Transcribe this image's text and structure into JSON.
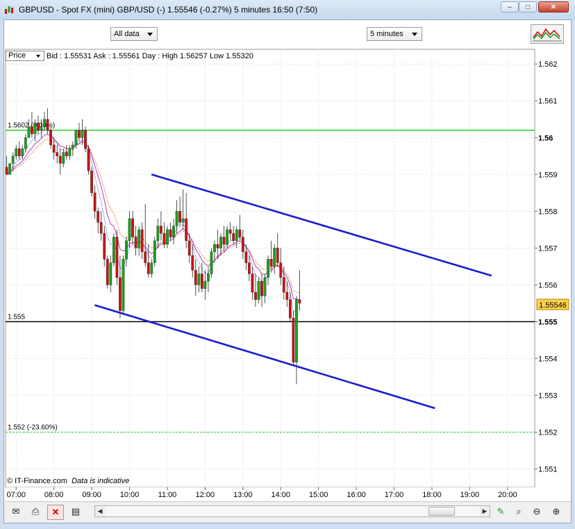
{
  "window": {
    "title": "GBPUSD - Spot FX (mini) GBP/USD (-)    1.55546 (-0.27%)    5 minutes  16:50 (7:50)",
    "minimize": "–",
    "maximize": "□",
    "close": "✕"
  },
  "toolbar": {
    "range_select": "All data",
    "interval_select": "5 minutes",
    "studies_icon": "chart-studies-icon"
  },
  "header": {
    "price_tab": "Price",
    "info": "Bid : 1.55531  Ask : 1.55561   Day : High 1.56257  Low 1.55320"
  },
  "copyright": {
    "brand": "© IT-Finance.com",
    "note": "Data is indicative"
  },
  "colors": {
    "up": "#1aa01a",
    "down": "#cc1111",
    "trendline": "#1a1ad0",
    "level_green": "#22cc22",
    "level_black": "#000000",
    "last_price_bg": "#ffd24a"
  },
  "chart_data": {
    "type": "candlestick",
    "x_ticks": [
      "07:00",
      "08:00",
      "09:00",
      "10:00",
      "11:00",
      "12:00",
      "13:00",
      "14:00",
      "15:00",
      "16:00",
      "17:00",
      "18:00",
      "19:00",
      "20:00"
    ],
    "y_ticks": [
      "1.562",
      "1.561",
      "1.56",
      "1.559",
      "1.558",
      "1.557",
      "1.556",
      "1.555",
      "1.554",
      "1.553",
      "1.552",
      "1.551"
    ],
    "bold_y_ticks": [
      "1.56",
      "1.555"
    ],
    "ylim": [
      1.5505,
      1.5624
    ],
    "x_range_hours": [
      6.72,
      20.72
    ],
    "last_price": "1.55546",
    "levels": [
      {
        "value": 1.5602,
        "label": "1.5602 (0.00%)",
        "color": "#22cc22",
        "style": "solid"
      },
      {
        "value": 1.555,
        "label": "1.555",
        "color": "#000000",
        "style": "solid"
      },
      {
        "value": 1.552,
        "label": "1.552 (-23.60%)",
        "color": "#22cc22",
        "style": "dashed"
      }
    ],
    "trendlines": [
      {
        "t1": 10.58,
        "v1": 1.559,
        "t2": 19.58,
        "v2": 1.55625
      },
      {
        "t1": 9.08,
        "v1": 1.55545,
        "t2": 18.08,
        "v2": 1.55265
      }
    ],
    "candles": [
      [
        1.5592,
        1.5595,
        1.559,
        1.559
      ],
      [
        1.559,
        1.5593,
        1.559,
        1.5593
      ],
      [
        1.5593,
        1.5596,
        1.5591,
        1.5595
      ],
      [
        1.5595,
        1.5598,
        1.5594,
        1.5597
      ],
      [
        1.5597,
        1.5599,
        1.5594,
        1.5595
      ],
      [
        1.5595,
        1.5598,
        1.5594,
        1.5597
      ],
      [
        1.5597,
        1.5601,
        1.5596,
        1.56
      ],
      [
        1.56,
        1.5605,
        1.56,
        1.5603
      ],
      [
        1.5603,
        1.5607,
        1.56,
        1.5601
      ],
      [
        1.5601,
        1.5605,
        1.5599,
        1.5604
      ],
      [
        1.5604,
        1.5606,
        1.5601,
        1.5602
      ],
      [
        1.5602,
        1.5605,
        1.56,
        1.5603
      ],
      [
        1.5603,
        1.5607,
        1.5602,
        1.5605
      ],
      [
        1.5605,
        1.5608,
        1.5601,
        1.5602
      ],
      [
        1.5602,
        1.5603,
        1.5597,
        1.5598
      ],
      [
        1.5598,
        1.56,
        1.5594,
        1.5596
      ],
      [
        1.5596,
        1.5598,
        1.5593,
        1.5595
      ],
      [
        1.5595,
        1.5597,
        1.559,
        1.5593
      ],
      [
        1.5593,
        1.5597,
        1.5592,
        1.5596
      ],
      [
        1.5596,
        1.5598,
        1.5594,
        1.5595
      ],
      [
        1.5595,
        1.5598,
        1.5594,
        1.5597
      ],
      [
        1.5597,
        1.5599,
        1.5595,
        1.5598
      ],
      [
        1.5598,
        1.5602,
        1.5597,
        1.5602
      ],
      [
        1.5602,
        1.5604,
        1.5599,
        1.56
      ],
      [
        1.56,
        1.5605,
        1.5598,
        1.5602
      ],
      [
        1.5602,
        1.5603,
        1.5596,
        1.5597
      ],
      [
        1.5597,
        1.5598,
        1.559,
        1.5591
      ],
      [
        1.5591,
        1.5592,
        1.5584,
        1.5585
      ],
      [
        1.5585,
        1.5587,
        1.5578,
        1.558
      ],
      [
        1.558,
        1.5581,
        1.5574,
        1.5577
      ],
      [
        1.5577,
        1.558,
        1.5572,
        1.5574
      ],
      [
        1.5574,
        1.5576,
        1.5565,
        1.5567
      ],
      [
        1.5567,
        1.5568,
        1.5559,
        1.556
      ],
      [
        1.556,
        1.5568,
        1.5558,
        1.5566
      ],
      [
        1.5566,
        1.5574,
        1.5565,
        1.5573
      ],
      [
        1.5573,
        1.5575,
        1.556,
        1.5562
      ],
      [
        1.5562,
        1.5568,
        1.5551,
        1.5553
      ],
      [
        1.5553,
        1.5568,
        1.5552,
        1.5567
      ],
      [
        1.5567,
        1.5573,
        1.5565,
        1.5572
      ],
      [
        1.5572,
        1.558,
        1.557,
        1.5578
      ],
      [
        1.5578,
        1.558,
        1.5571,
        1.5573
      ],
      [
        1.5573,
        1.5576,
        1.5568,
        1.557
      ],
      [
        1.557,
        1.5576,
        1.5568,
        1.5575
      ],
      [
        1.5575,
        1.5577,
        1.5567,
        1.5569
      ],
      [
        1.5569,
        1.5582,
        1.5565,
        1.5566
      ],
      [
        1.5566,
        1.5571,
        1.5562,
        1.5563
      ],
      [
        1.5563,
        1.5567,
        1.5562,
        1.5566
      ],
      [
        1.5566,
        1.5573,
        1.5565,
        1.5572
      ],
      [
        1.5572,
        1.5578,
        1.557,
        1.5576
      ],
      [
        1.5576,
        1.558,
        1.5572,
        1.5574
      ],
      [
        1.5574,
        1.5577,
        1.557,
        1.5571
      ],
      [
        1.5571,
        1.5576,
        1.557,
        1.5575
      ],
      [
        1.5575,
        1.5577,
        1.5572,
        1.5573
      ],
      [
        1.5573,
        1.5578,
        1.5571,
        1.5576
      ],
      [
        1.5576,
        1.5583,
        1.5574,
        1.558
      ],
      [
        1.558,
        1.5584,
        1.5576,
        1.5577
      ],
      [
        1.5577,
        1.5586,
        1.5575,
        1.5578
      ],
      [
        1.5578,
        1.5585,
        1.557,
        1.5572
      ],
      [
        1.5572,
        1.5574,
        1.5566,
        1.5568
      ],
      [
        1.5568,
        1.5571,
        1.5562,
        1.5564
      ],
      [
        1.5564,
        1.5567,
        1.5557,
        1.556
      ],
      [
        1.556,
        1.5565,
        1.5558,
        1.5563
      ],
      [
        1.5563,
        1.5566,
        1.5558,
        1.5559
      ],
      [
        1.5559,
        1.5564,
        1.5556,
        1.5561
      ],
      [
        1.5561,
        1.5565,
        1.5558,
        1.5563
      ],
      [
        1.5563,
        1.557,
        1.5562,
        1.5569
      ],
      [
        1.5569,
        1.5572,
        1.5566,
        1.5571
      ],
      [
        1.5571,
        1.5575,
        1.5567,
        1.557
      ],
      [
        1.557,
        1.5574,
        1.5568,
        1.5573
      ],
      [
        1.5573,
        1.5576,
        1.5569,
        1.5571
      ],
      [
        1.5571,
        1.5576,
        1.557,
        1.5575
      ],
      [
        1.5575,
        1.5577,
        1.5572,
        1.5574
      ],
      [
        1.5574,
        1.5576,
        1.5571,
        1.5572
      ],
      [
        1.5572,
        1.5576,
        1.557,
        1.5575
      ],
      [
        1.5575,
        1.5579,
        1.5572,
        1.5573
      ],
      [
        1.5573,
        1.5575,
        1.5567,
        1.5569
      ],
      [
        1.5569,
        1.5571,
        1.5564,
        1.5566
      ],
      [
        1.5566,
        1.5568,
        1.5561,
        1.5563
      ],
      [
        1.5563,
        1.5565,
        1.5556,
        1.5558
      ],
      [
        1.5558,
        1.5563,
        1.5554,
        1.5556
      ],
      [
        1.5556,
        1.5562,
        1.5555,
        1.5561
      ],
      [
        1.5561,
        1.5563,
        1.5554,
        1.5557
      ],
      [
        1.5557,
        1.5563,
        1.5555,
        1.5562
      ],
      [
        1.5562,
        1.5568,
        1.556,
        1.5567
      ],
      [
        1.5567,
        1.5572,
        1.5564,
        1.5565
      ],
      [
        1.5565,
        1.5571,
        1.5563,
        1.557
      ],
      [
        1.557,
        1.5574,
        1.5565,
        1.5566
      ],
      [
        1.5566,
        1.557,
        1.556,
        1.5562
      ],
      [
        1.5562,
        1.5565,
        1.5556,
        1.5558
      ],
      [
        1.5558,
        1.5561,
        1.5554,
        1.5556
      ],
      [
        1.5556,
        1.5558,
        1.555,
        1.5551
      ],
      [
        1.5551,
        1.5553,
        1.5538,
        1.5539
      ],
      [
        1.5539,
        1.5557,
        1.5533,
        1.5556
      ],
      [
        1.5556,
        1.5564,
        1.5553,
        1.5555
      ]
    ]
  }
}
